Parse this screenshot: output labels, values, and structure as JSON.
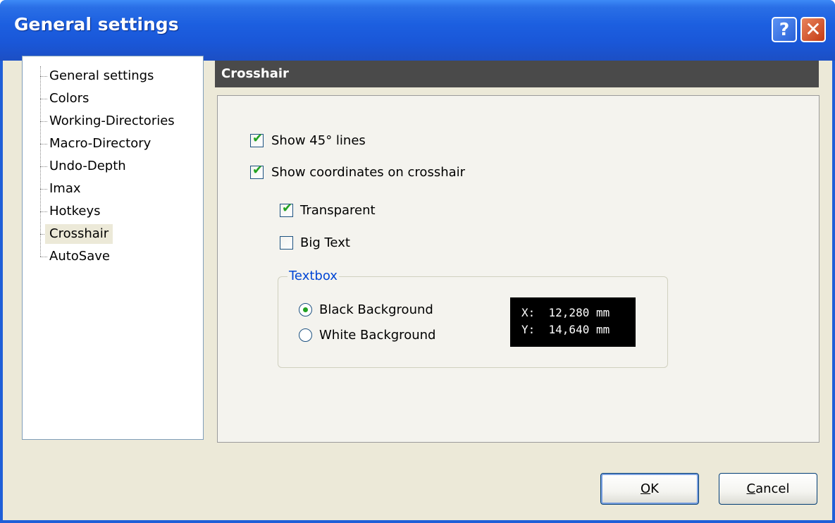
{
  "window": {
    "title": "General settings",
    "help_label": "?",
    "close_label": "✕"
  },
  "tree": {
    "items": [
      {
        "label": "General settings",
        "selected": false
      },
      {
        "label": "Colors",
        "selected": false
      },
      {
        "label": "Working-Directories",
        "selected": false
      },
      {
        "label": "Macro-Directory",
        "selected": false
      },
      {
        "label": "Undo-Depth",
        "selected": false
      },
      {
        "label": "Imax",
        "selected": false
      },
      {
        "label": "Hotkeys",
        "selected": false
      },
      {
        "label": "Crosshair",
        "selected": true
      },
      {
        "label": "AutoSave",
        "selected": false
      }
    ]
  },
  "section": {
    "title": "Crosshair"
  },
  "options": {
    "show_45": {
      "label": "Show 45° lines",
      "checked": true
    },
    "show_coords": {
      "label": "Show coordinates on crosshair",
      "checked": true
    },
    "transparent": {
      "label": "Transparent",
      "checked": true
    },
    "big_text": {
      "label": "Big Text",
      "checked": false
    }
  },
  "textbox": {
    "title": "Textbox",
    "black_label": "Black Background",
    "white_label": "White Background",
    "selected": "black",
    "preview": {
      "x_line": "X:  12,280 mm",
      "y_line": "Y:  14,640 mm"
    }
  },
  "buttons": {
    "ok_u": "O",
    "ok_rest": "K",
    "cancel_u": "C",
    "cancel_rest": "ancel"
  },
  "colors": {
    "titlebar": "#1c5fe0",
    "section_header": "#4a4a4a",
    "check": "#21a121",
    "group_title": "#0046d5"
  }
}
